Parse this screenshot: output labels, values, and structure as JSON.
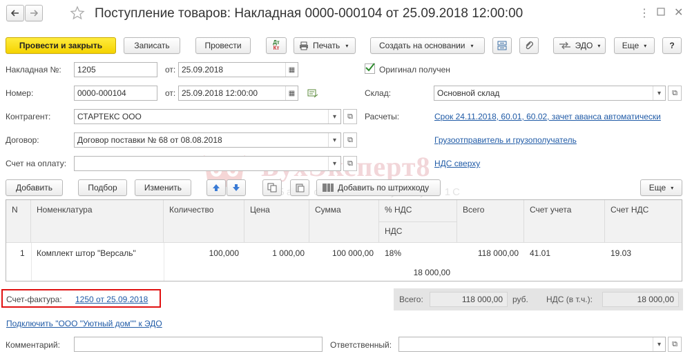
{
  "title": "Поступление товаров: Накладная 0000-000104 от 25.09.2018 12:00:00",
  "toolbar": {
    "post_close": "Провести и закрыть",
    "save": "Записать",
    "post": "Провести",
    "dtkt": "Дт Кт",
    "print": "Печать",
    "create_based": "Создать на основании",
    "edo": "ЭДО",
    "more": "Еще",
    "help": "?"
  },
  "header": {
    "invoice_no_label": "Накладная №:",
    "invoice_no": "1205",
    "from_label": "от:",
    "invoice_date": "25.09.2018",
    "original_label": "Оригинал получен",
    "number_label": "Номер:",
    "number": "0000-000104",
    "doc_date": "25.09.2018 12:00:00",
    "warehouse_label": "Склад:",
    "warehouse": "Основной склад",
    "counterparty_label": "Контрагент:",
    "counterparty": "СТАРТЕКС ООО",
    "settlements_label": "Расчеты:",
    "settlements_link": "Срок 24.11.2018, 60.01, 60.02, зачет аванса автоматически",
    "contract_label": "Договор:",
    "contract": "Договор поставки № 68 от 08.08.2018",
    "shipper_link": "Грузоотправитель и грузополучатель",
    "pay_invoice_label": "Счет на оплату:",
    "pay_invoice": "",
    "vat_link": "НДС сверху"
  },
  "watermark": {
    "brand": "БухЭксперт8",
    "tagline": "База ответов по учету в 1С"
  },
  "table_toolbar": {
    "add": "Добавить",
    "pick": "Подбор",
    "edit": "Изменить",
    "barcode": "Добавить по штрихкоду",
    "more": "Еще"
  },
  "table": {
    "columns": {
      "n": "N",
      "item": "Номенклатура",
      "qty": "Количество",
      "price": "Цена",
      "sum": "Сумма",
      "vat_rate": "% НДС",
      "vat": "НДС",
      "total": "Всего",
      "account": "Счет учета",
      "vat_account": "Счет НДС"
    },
    "rows": [
      {
        "n": "1",
        "item": "Комплект штор \"Версаль\"",
        "qty": "100,000",
        "price": "1 000,00",
        "sum": "100 000,00",
        "vat_rate": "18%",
        "vat": "18 000,00",
        "total": "118 000,00",
        "account": "41.01",
        "vat_account": "19.03"
      }
    ]
  },
  "footer": {
    "invoice_label": "Счет-фактура:",
    "invoice_link": "1250 от 25.09.2018",
    "total_label": "Всего:",
    "total_value": "118 000,00",
    "currency": "руб.",
    "vat_label": "НДС (в т.ч.):",
    "vat_value": "18 000,00",
    "edo_link": "Подключить \"ООО \"Уютный дом\"\" к ЭДО",
    "comment_label": "Комментарий:",
    "comment": "",
    "responsible_label": "Ответственный:",
    "responsible": ""
  },
  "colors": {
    "primary_button": "#f5d300",
    "link": "#1f5aa6",
    "highlight_frame": "#e01010"
  }
}
